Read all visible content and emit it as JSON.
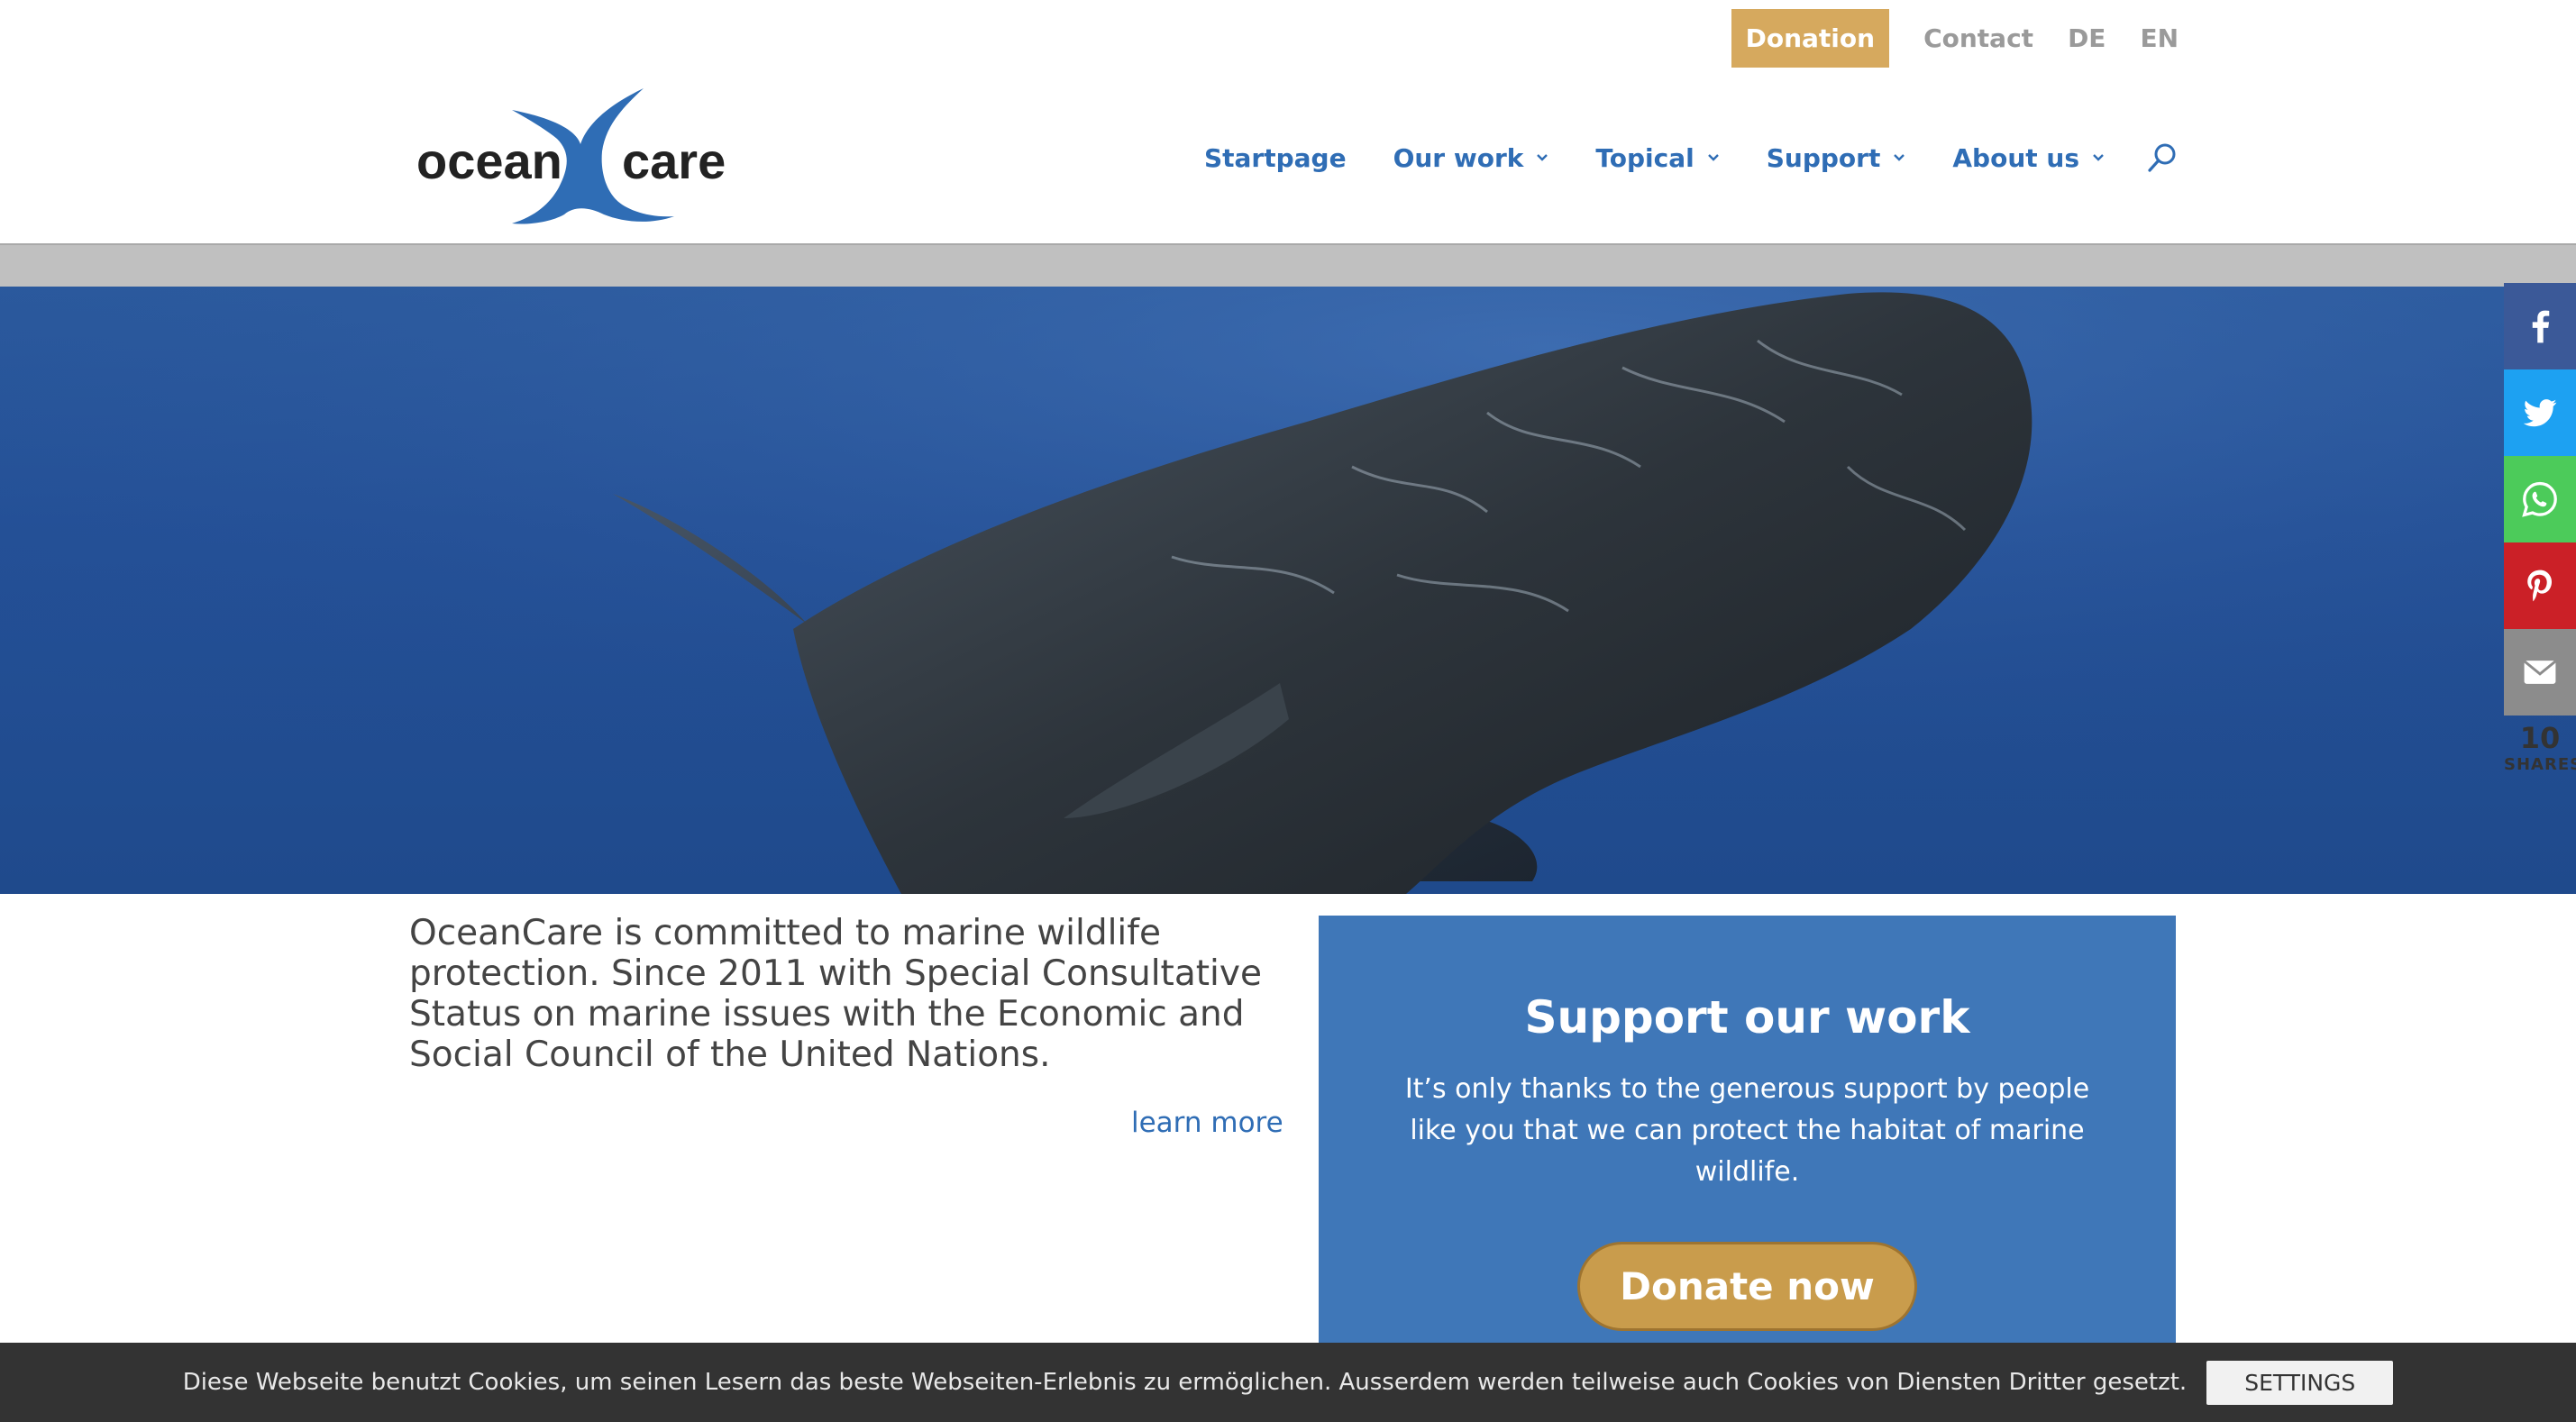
{
  "topbar": {
    "donation_label": "Donation",
    "contact_label": "Contact",
    "lang_de": "DE",
    "lang_en": "EN"
  },
  "logo": {
    "text_left": "ocean",
    "text_right": "care"
  },
  "nav": {
    "items": [
      {
        "label": "Startpage",
        "has_dropdown": false
      },
      {
        "label": "Our work",
        "has_dropdown": true
      },
      {
        "label": "Topical",
        "has_dropdown": true
      },
      {
        "label": "Support",
        "has_dropdown": true
      },
      {
        "label": "About us",
        "has_dropdown": true
      }
    ],
    "search_icon": "search-icon"
  },
  "share": {
    "icons": [
      "facebook-icon",
      "twitter-icon",
      "whatsapp-icon",
      "pinterest-icon",
      "email-icon"
    ],
    "count": "10",
    "label": "SHARES"
  },
  "intro": {
    "text": "OceanCare is committed to marine wildlife protection. Since 2011 with Special Consultative Status on marine issues with the Economic and Social Council of the United Nations.",
    "learn_more": "learn more"
  },
  "support": {
    "title": "Support our work",
    "text": "It’s only thanks to the generous support by people like you that we can protect the habitat of marine wildlife.",
    "button": "Donate now"
  },
  "cookie": {
    "text": "Diese Webseite benutzt Cookies, um seinen Lesern das beste Webseiten-Erlebnis zu ermöglichen. Ausserdem werden teilweise auch Cookies von Diensten Dritter gesetzt.",
    "button": "SETTINGS"
  },
  "colors": {
    "brand_blue": "#2f6db5",
    "gold": "#d6a95e",
    "support_bg": "#3f77b8",
    "cookie_bg": "#333333"
  }
}
